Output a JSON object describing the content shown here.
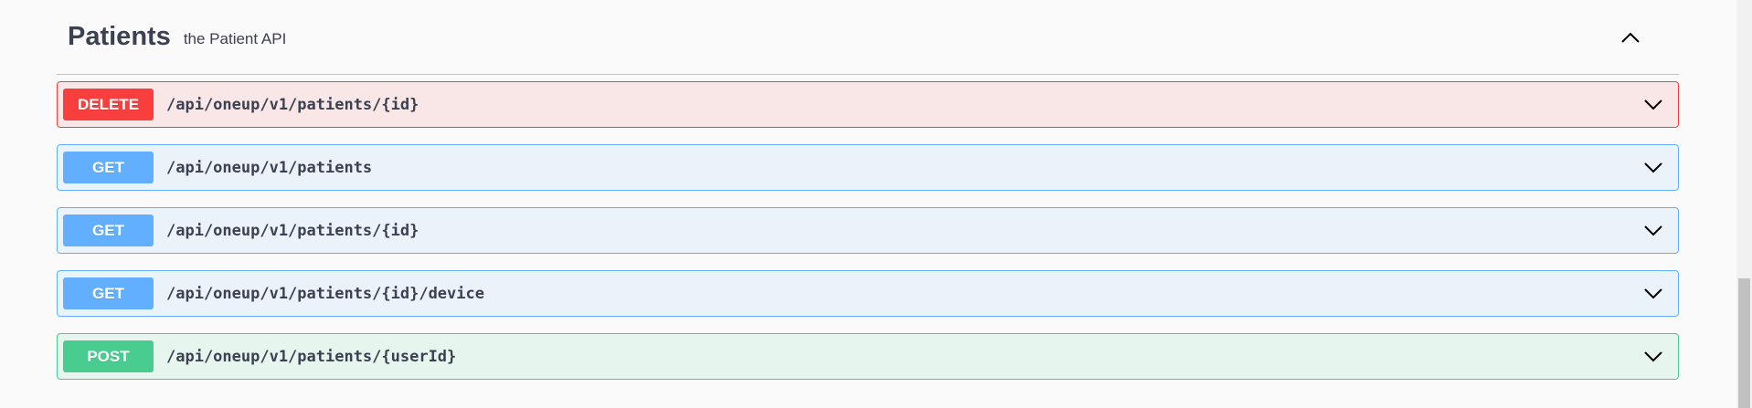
{
  "tag": {
    "name": "Patients",
    "description": "the Patient API"
  },
  "operations": [
    {
      "method": "DELETE",
      "method_class": "delete",
      "path": "/api/oneup/v1/patients/{id}"
    },
    {
      "method": "GET",
      "method_class": "get",
      "path": "/api/oneup/v1/patients"
    },
    {
      "method": "GET",
      "method_class": "get",
      "path": "/api/oneup/v1/patients/{id}"
    },
    {
      "method": "GET",
      "method_class": "get",
      "path": "/api/oneup/v1/patients/{id}/device"
    },
    {
      "method": "POST",
      "method_class": "post",
      "path": "/api/oneup/v1/patients/{userId}"
    }
  ],
  "colors": {
    "delete": "#f93e3e",
    "get": "#61affe",
    "post": "#49cc90",
    "text": "#3b4151"
  },
  "icons": {
    "collapse": "chevron-up-icon",
    "expand": "chevron-down-icon"
  }
}
